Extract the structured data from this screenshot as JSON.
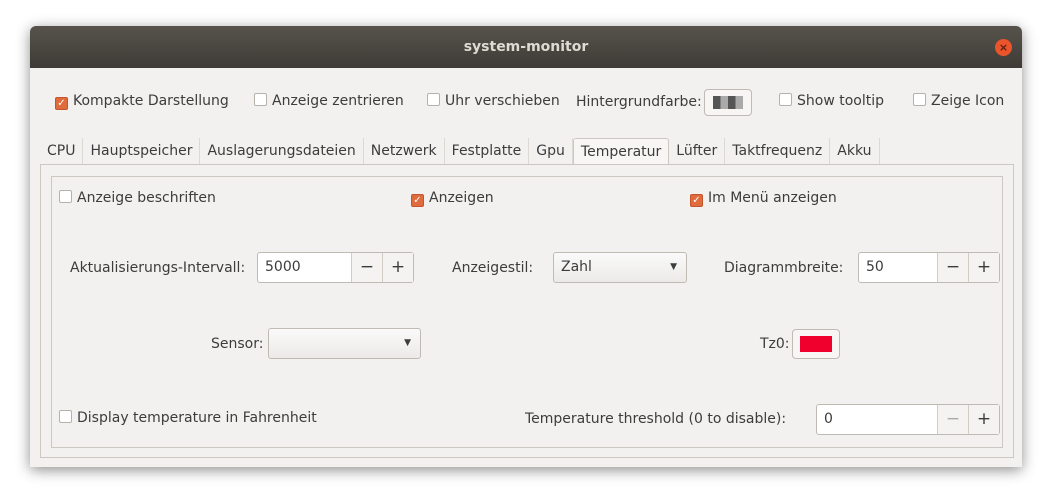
{
  "window": {
    "title": "system-monitor"
  },
  "top": {
    "compact": {
      "label": "Kompakte Darstellung",
      "checked": true
    },
    "center": {
      "label": "Anzeige zentrieren",
      "checked": false
    },
    "clock": {
      "label": "Uhr verschieben",
      "checked": false
    },
    "bg_label": "Hintergrundfarbe:",
    "tooltip": {
      "label": "Show tooltip",
      "checked": false
    },
    "icon": {
      "label": "Zeige Icon",
      "checked": false
    }
  },
  "tabs": [
    "CPU",
    "Hauptspeicher",
    "Auslagerungsdateien",
    "Netzwerk",
    "Festplatte",
    "Gpu",
    "Temperatur",
    "Lüfter",
    "Taktfrequenz",
    "Akku"
  ],
  "active_tab": "Temperatur",
  "panel": {
    "label_display": {
      "label": "Anzeige beschriften",
      "checked": false
    },
    "display": {
      "label": "Anzeigen",
      "checked": true
    },
    "menu": {
      "label": "Im Menü anzeigen",
      "checked": true
    },
    "interval_label": "Aktualisierungs-Intervall:",
    "interval": "5000",
    "style_label": "Anzeigestil:",
    "style": "Zahl",
    "width_label": "Diagrammbreite:",
    "width": "50",
    "sensor_label": "Sensor:",
    "sensor": "",
    "tz_label": "Tz0:",
    "tz_color": "#f0002c",
    "fahrenheit": {
      "label": "Display temperature in Fahrenheit",
      "checked": false
    },
    "threshold_label": "Temperature threshold (0 to disable):",
    "threshold": "0",
    "minus": "−",
    "plus": "+"
  }
}
